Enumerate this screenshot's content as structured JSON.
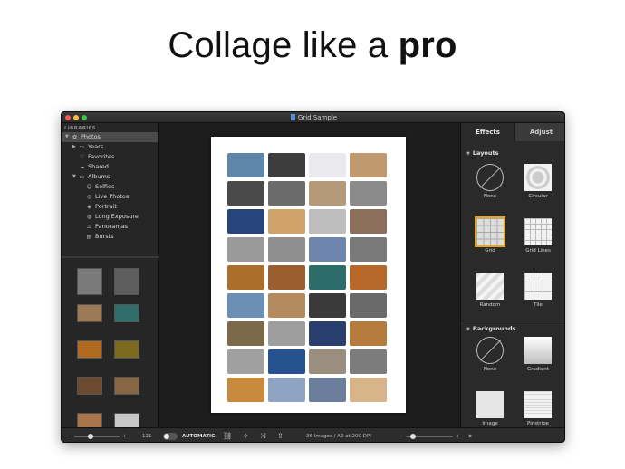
{
  "headline": {
    "prefix": "Collage like a ",
    "bold": "pro"
  },
  "window": {
    "title": "Grid Sample"
  },
  "sidebar": {
    "section_label": "LIBRARIES",
    "items": [
      {
        "label": "Photos",
        "indent": 0,
        "icon": "photos-icon",
        "glyph": "✿",
        "tri": "▼",
        "selected": true
      },
      {
        "label": "Years",
        "indent": 1,
        "icon": "folder-icon",
        "glyph": "▭",
        "tri": "▶"
      },
      {
        "label": "Favorites",
        "indent": 1,
        "icon": "heart-icon",
        "glyph": "♡"
      },
      {
        "label": "Shared",
        "indent": 1,
        "icon": "cloud-icon",
        "glyph": "☁"
      },
      {
        "label": "Albums",
        "indent": 1,
        "icon": "folder-icon",
        "glyph": "▭",
        "tri": "▼"
      },
      {
        "label": "Selfies",
        "indent": 2,
        "icon": "person-icon",
        "glyph": "☺"
      },
      {
        "label": "Live Photos",
        "indent": 2,
        "icon": "live-photo-icon",
        "glyph": "◎"
      },
      {
        "label": "Portrait",
        "indent": 2,
        "icon": "cube-icon",
        "glyph": "◈"
      },
      {
        "label": "Long Exposure",
        "indent": 2,
        "icon": "exposure-icon",
        "glyph": "◍"
      },
      {
        "label": "Panoramas",
        "indent": 2,
        "icon": "panorama-icon",
        "glyph": "⌓"
      },
      {
        "label": "Bursts",
        "indent": 2,
        "icon": "bursts-icon",
        "glyph": "▤"
      }
    ]
  },
  "thumbnails": [
    {
      "color": "#7a7a7a"
    },
    {
      "color": "#5e5e5e"
    },
    {
      "color": "#9b7a55"
    },
    {
      "color": "#2f6e6a"
    },
    {
      "color": "#b06a22"
    },
    {
      "color": "#7b6a1f"
    },
    {
      "color": "#6b4a2f"
    },
    {
      "color": "#876645"
    },
    {
      "color": "#a8764a"
    },
    {
      "color": "#c8c8c8"
    }
  ],
  "collage": {
    "cells": [
      "#5d86a8",
      "#3d3d3d",
      "#e9e9ee",
      "#c0996e",
      "#4a4a4a",
      "#6b6b6b",
      "#b59a7a",
      "#8a8a8a",
      "#27457a",
      "#cfa36b",
      "#bdbdbd",
      "#8b6f5c",
      "#9a9a9a",
      "#8f8f8f",
      "#6e86ad",
      "#7a7a7a",
      "#ab6f2b",
      "#9a5e2f",
      "#2c6d69",
      "#b6672a",
      "#6b8fb5",
      "#b58a5c",
      "#3a3a3a",
      "#6a6a6a",
      "#7a6a4a",
      "#9e9e9e",
      "#2a3f6e",
      "#b57c3e",
      "#a0a0a0",
      "#25528f",
      "#9b8e7e",
      "#7c7c7c",
      "#c98a3e",
      "#8fa4c3",
      "#6a7e9b",
      "#d7b48a"
    ]
  },
  "right_panel": {
    "tabs": [
      {
        "label": "Effects",
        "active": true
      },
      {
        "label": "Adjust",
        "active": false
      }
    ],
    "layouts": {
      "title": "Layouts",
      "options": [
        {
          "label": "None",
          "kind": "none"
        },
        {
          "label": "Circular",
          "kind": "circular"
        },
        {
          "label": "Grid",
          "kind": "grid",
          "selected": true
        },
        {
          "label": "Grid Lines",
          "kind": "gridlines"
        },
        {
          "label": "Random",
          "kind": "random"
        },
        {
          "label": "Tile",
          "kind": "tile"
        }
      ]
    },
    "backgrounds": {
      "title": "Backgrounds",
      "options": [
        {
          "label": "None",
          "kind": "none"
        },
        {
          "label": "Gradient",
          "kind": "gradient"
        },
        {
          "label": "Image",
          "kind": "image"
        },
        {
          "label": "Pinstripe",
          "kind": "pinstripe"
        }
      ]
    }
  },
  "bottom_bar": {
    "thumb_size_minus": "−",
    "thumb_size_plus": "+",
    "photo_count": "121",
    "auto_label": "AUTOMATIC",
    "status": "36 Images / A2 at 200 DPI",
    "zoom_minus": "−",
    "zoom_plus": "+",
    "thumb_slider_value": 0.35,
    "zoom_slider_value": 0.1
  },
  "colors": {
    "accent": "#e5a821",
    "bg": "#1f1f1f",
    "panel": "#2a2a2a"
  }
}
